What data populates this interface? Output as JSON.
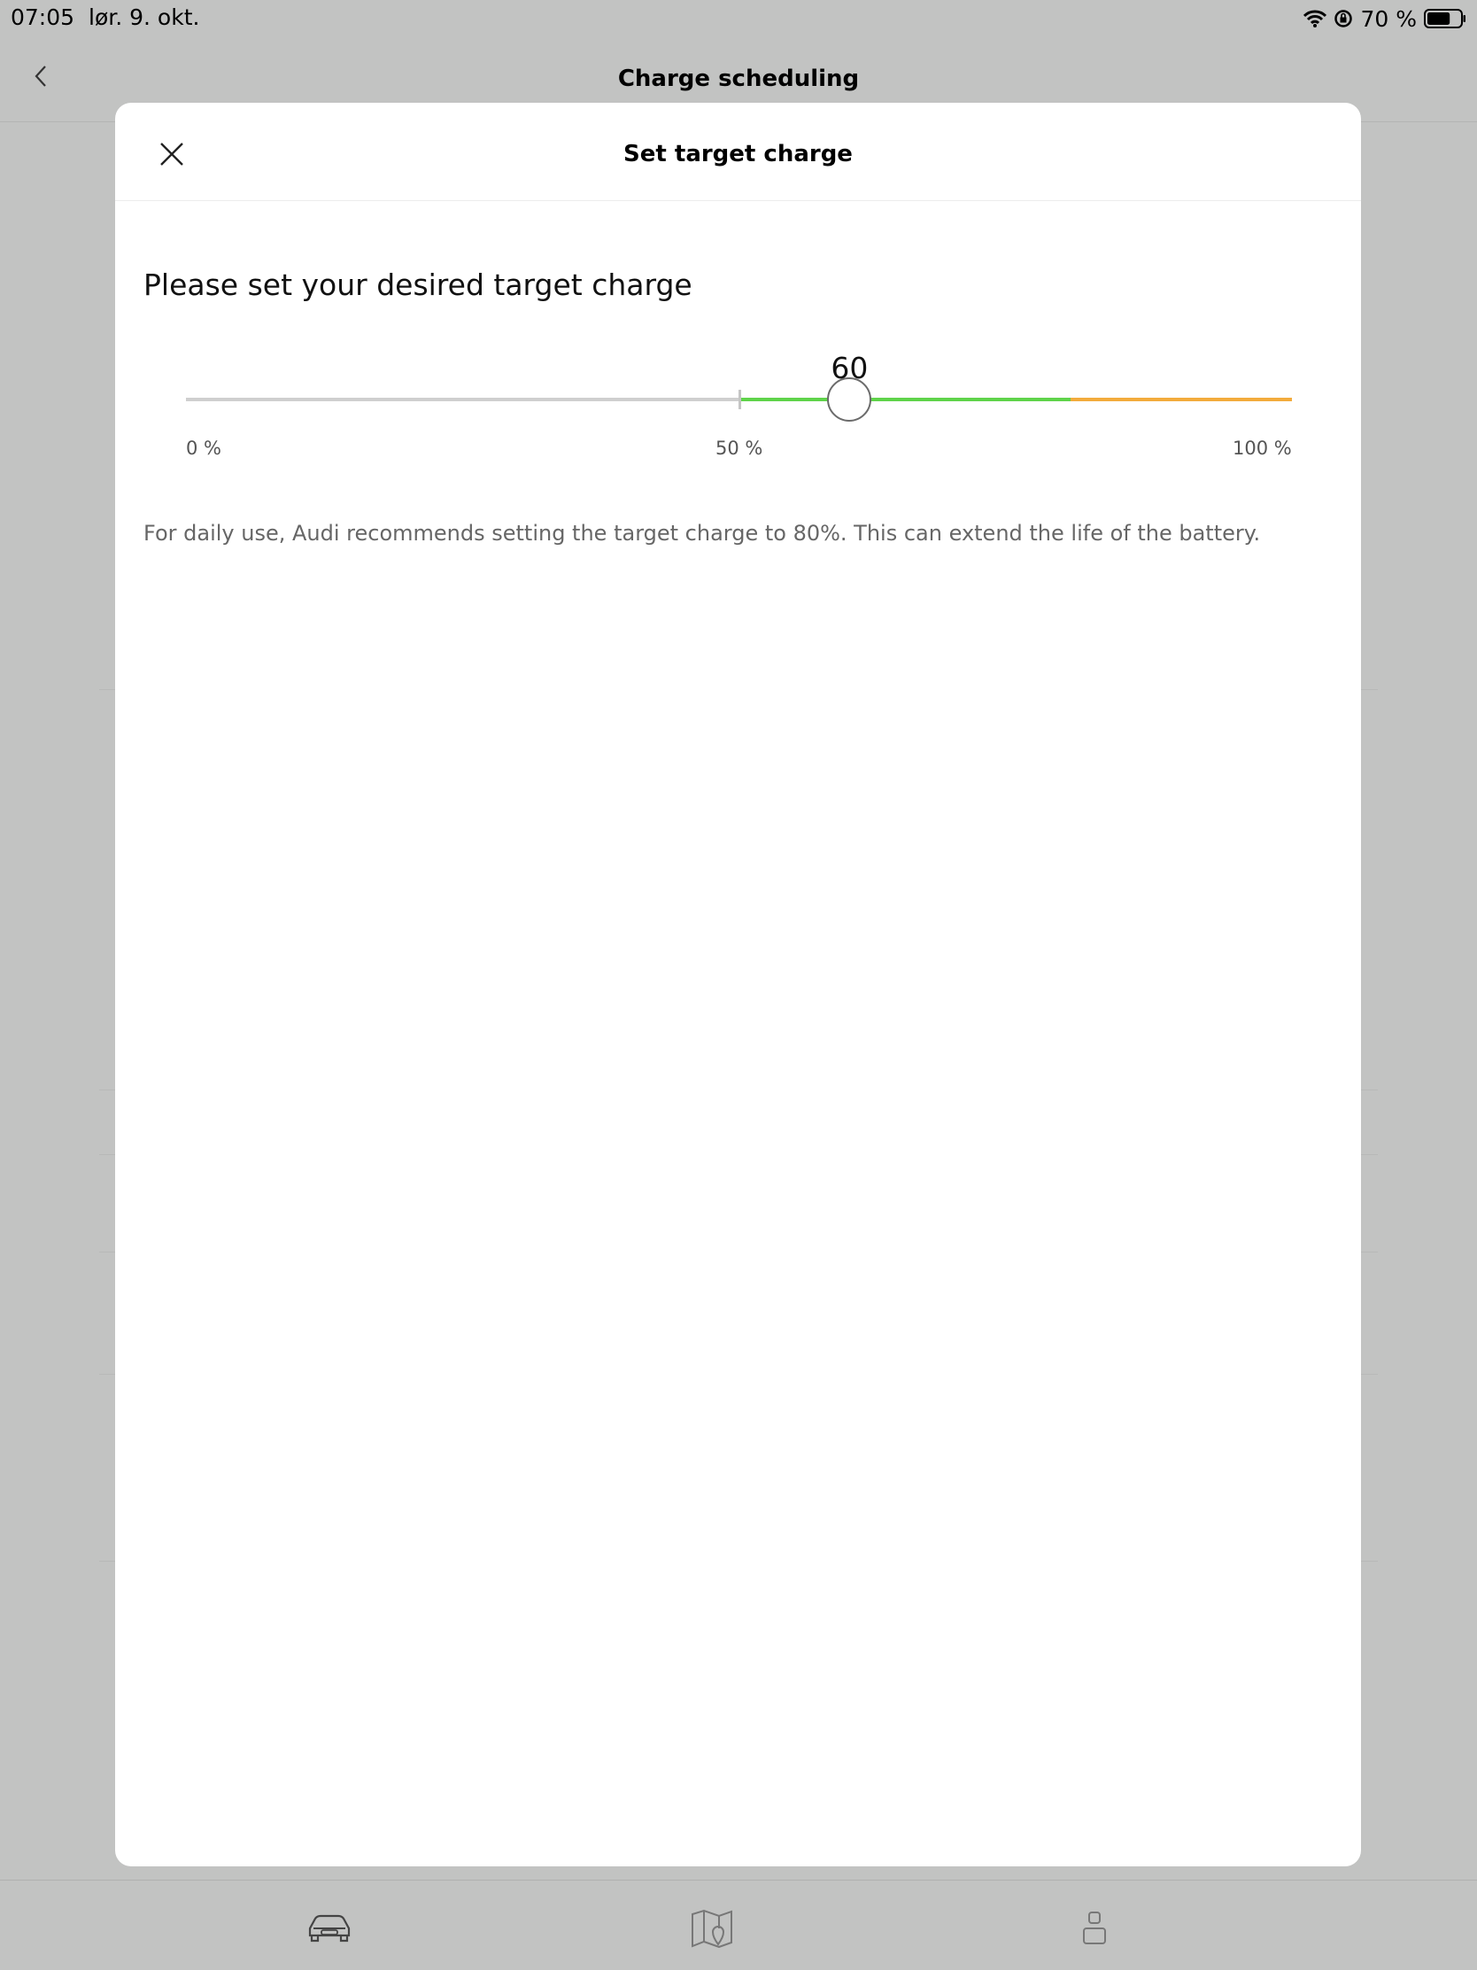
{
  "status_bar": {
    "time": "07:05",
    "date": "lør. 9. okt.",
    "battery_percent": "70 %",
    "battery_level": 0.7
  },
  "nav": {
    "title": "Charge scheduling"
  },
  "modal": {
    "title": "Set target charge",
    "prompt": "Please set your desired target charge",
    "slider": {
      "value": 60,
      "value_label": "60",
      "min": 0,
      "max": 100,
      "threshold": 50,
      "recommended": 80,
      "min_label": "0 %",
      "mid_label": "50 %",
      "max_label": "100 %",
      "colors": {
        "below_threshold": "#cfcfcf",
        "recommended": "#5fd34a",
        "above_recommended": "#f2ab3c"
      }
    },
    "info": "For daily use, Audi recommends setting the target charge to 80%. This can extend the life of the battery."
  },
  "tabs": [
    {
      "icon": "car-icon"
    },
    {
      "icon": "map-icon"
    },
    {
      "icon": "profile-icon"
    }
  ]
}
